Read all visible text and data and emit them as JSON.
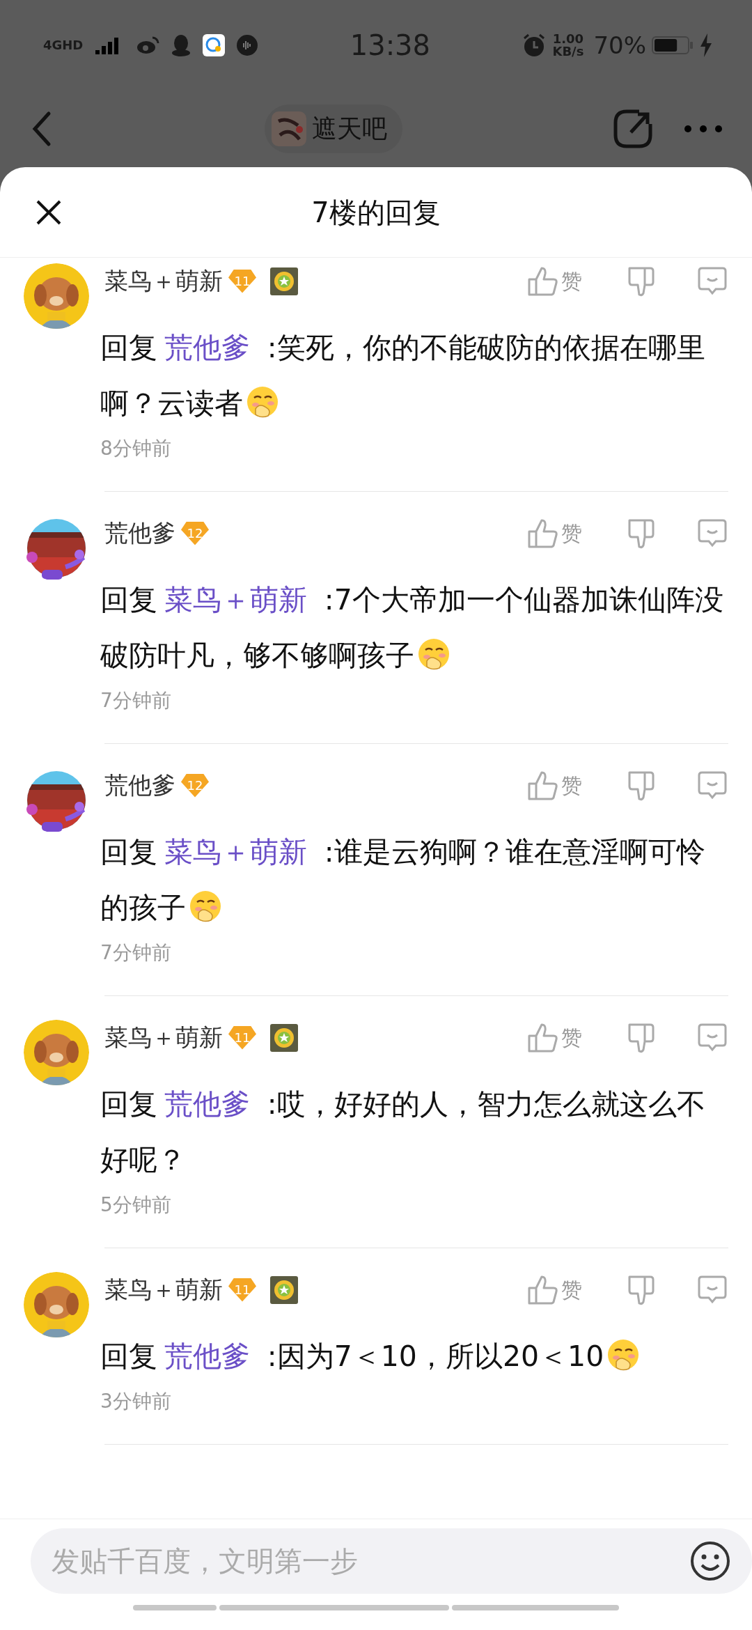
{
  "status_bar": {
    "network": "4GHD",
    "time": "13:38",
    "speed": "1.00",
    "speed_unit": "KB/s",
    "battery": "70%"
  },
  "nav": {
    "forum": "遮天吧"
  },
  "sheet": {
    "title": "7楼的回复"
  },
  "comments": [
    {
      "user": "菜鸟＋萌新",
      "level": "11",
      "medal": true,
      "like_label": "赞",
      "prefix": "回复",
      "target": "荒他爹",
      "text": ":笑死，你的不能破防的依据在哪里啊？云读者",
      "emoji": true,
      "time": "8分钟前"
    },
    {
      "user": "荒他爹",
      "level": "12",
      "medal": false,
      "like_label": "赞",
      "prefix": "回复",
      "target": "菜鸟＋萌新",
      "text": ":7个大帝加一个仙器加诛仙阵没破防叶凡，够不够啊孩子",
      "emoji": true,
      "time": "7分钟前"
    },
    {
      "user": "荒他爹",
      "level": "12",
      "medal": false,
      "like_label": "赞",
      "prefix": "回复",
      "target": "菜鸟＋萌新",
      "text": ":谁是云狗啊？谁在意淫啊可怜的孩子",
      "emoji": true,
      "time": "7分钟前"
    },
    {
      "user": "菜鸟＋萌新",
      "level": "11",
      "medal": true,
      "like_label": "赞",
      "prefix": "回复",
      "target": "荒他爹",
      "text": ":哎，好好的人，智力怎么就这么不好呢？",
      "emoji": false,
      "time": "5分钟前"
    },
    {
      "user": "菜鸟＋萌新",
      "level": "11",
      "medal": true,
      "like_label": "赞",
      "prefix": "回复",
      "target": "荒他爹",
      "text": ":因为7＜10，所以20＜10",
      "emoji": true,
      "time": "3分钟前"
    }
  ],
  "composer": {
    "placeholder": "发贴千百度，文明第一步"
  }
}
